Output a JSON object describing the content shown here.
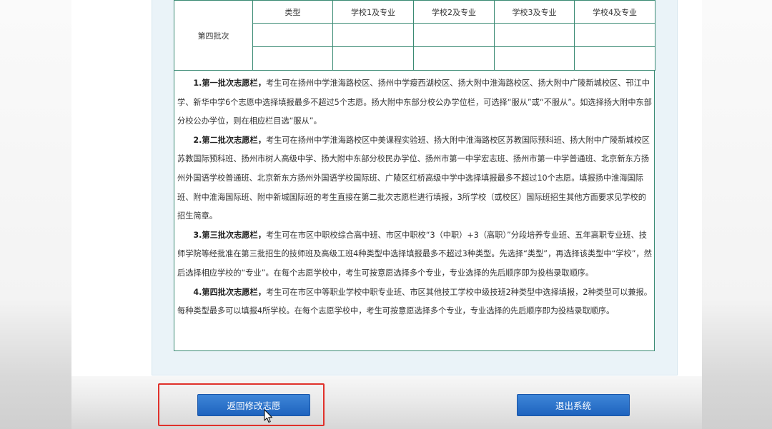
{
  "batch_table": {
    "row_label": "第四批次",
    "headers": [
      "类型",
      "学校1及专业",
      "学校2及专业",
      "学校3及专业",
      "学校4及专业"
    ]
  },
  "notes": [
    {
      "title": "1.第一批次志愿栏，",
      "text": "考生可在扬州中学淮海路校区、扬州中学瘦西湖校区、扬大附中淮海路校区、扬大附中广陵新城校区、邗江中学、新华中学6个志愿中选择填报最多不超过5个志愿。扬大附中东部分校公办学位栏，可选择“服从”或“不服从”。如选择扬大附中东部分校公办学位，则在相应栏目选“服从”。"
    },
    {
      "title": "2.第二批次志愿栏，",
      "text": "考生可在扬州中学淮海路校区中美课程实验班、扬大附中淮海路校区苏教国际预科班、扬大附中广陵新城校区苏教国际预科班、扬州市树人高级中学、扬大附中东部分校民办学位、扬州市第一中学宏志班、扬州市第一中学普通班、北京新东方扬州外国语学校普通班、北京新东方扬州外国语学校国际班、广陵区红桥高级中学中选择填报最多不超过10个志愿。填报扬中淮海国际班、附中淮海国际班、附中新城国际班的考生直接在第二批次志愿栏进行填报，3所学校（或校区）国际班招生其他方面要求见学校的招生简章。"
    },
    {
      "title": "3.第三批次志愿栏，",
      "text": "考生可在市区中职校综合高中班、市区中职校“3（中职）+3（高职）”分段培养专业班、五年高职专业班、技师学院等经批准在第三批招生的技师班及高级工班4种类型中选择填报最多不超过3种类型。先选择“类型”，再选择该类型中“学校”，然后选择相应学校的“专业”。在每个志愿学校中，考生可按意愿选择多个专业，专业选择的先后顺序即为投档录取顺序。"
    },
    {
      "title": "4.第四批次志愿栏，",
      "text": "考生可在市区中等职业学校中职专业班、市区其他技工学校中级技班2种类型中选择填报，2种类型可以兼报。每种类型最多可以填报4所学校。在每个志愿学校中，考生可按意愿选择多个专业，专业选择的先后顺序即为投档录取顺序。"
    }
  ],
  "buttons": {
    "back": "返回修改志愿",
    "exit": "退出系统"
  },
  "colors": {
    "table_border": "#3a8a73",
    "button_blue": "#1e63be",
    "highlight_red": "#e0312b"
  }
}
